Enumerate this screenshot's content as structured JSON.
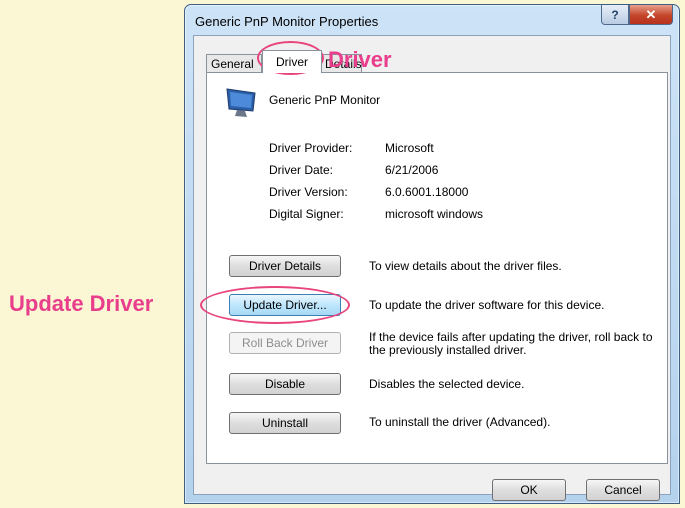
{
  "window": {
    "title": "Generic PnP Monitor Properties",
    "help_glyph": "?",
    "close_glyph": "✕"
  },
  "tabs": [
    {
      "label": "General",
      "active": false
    },
    {
      "label": "Driver",
      "active": true
    },
    {
      "label": "Details",
      "active": false
    }
  ],
  "device": {
    "name": "Generic PnP Monitor",
    "icon": "monitor-icon"
  },
  "info": [
    {
      "label": "Driver Provider:",
      "value": "Microsoft"
    },
    {
      "label": "Driver Date:",
      "value": "6/21/2006"
    },
    {
      "label": "Driver Version:",
      "value": "6.0.6001.18000"
    },
    {
      "label": "Digital Signer:",
      "value": "microsoft windows"
    }
  ],
  "actions": [
    {
      "label": "Driver Details",
      "description": "To view details about the driver files.",
      "enabled": true
    },
    {
      "label": "Update Driver...",
      "description": "To update the driver software for this device.",
      "enabled": true
    },
    {
      "label": "Roll Back Driver",
      "description": "If the device fails after updating the driver, roll back to the previously installed driver.",
      "enabled": false
    },
    {
      "label": "Disable",
      "description": "Disables the selected device.",
      "enabled": true
    },
    {
      "label": "Uninstall",
      "description": "To uninstall the driver (Advanced).",
      "enabled": true
    }
  ],
  "footer": {
    "ok": "OK",
    "cancel": "Cancel"
  },
  "annotations": {
    "driver": "Driver",
    "update_driver": "Update Driver"
  },
  "colors": {
    "annotation": "#e83e8c",
    "background": "#fbf6d3"
  }
}
